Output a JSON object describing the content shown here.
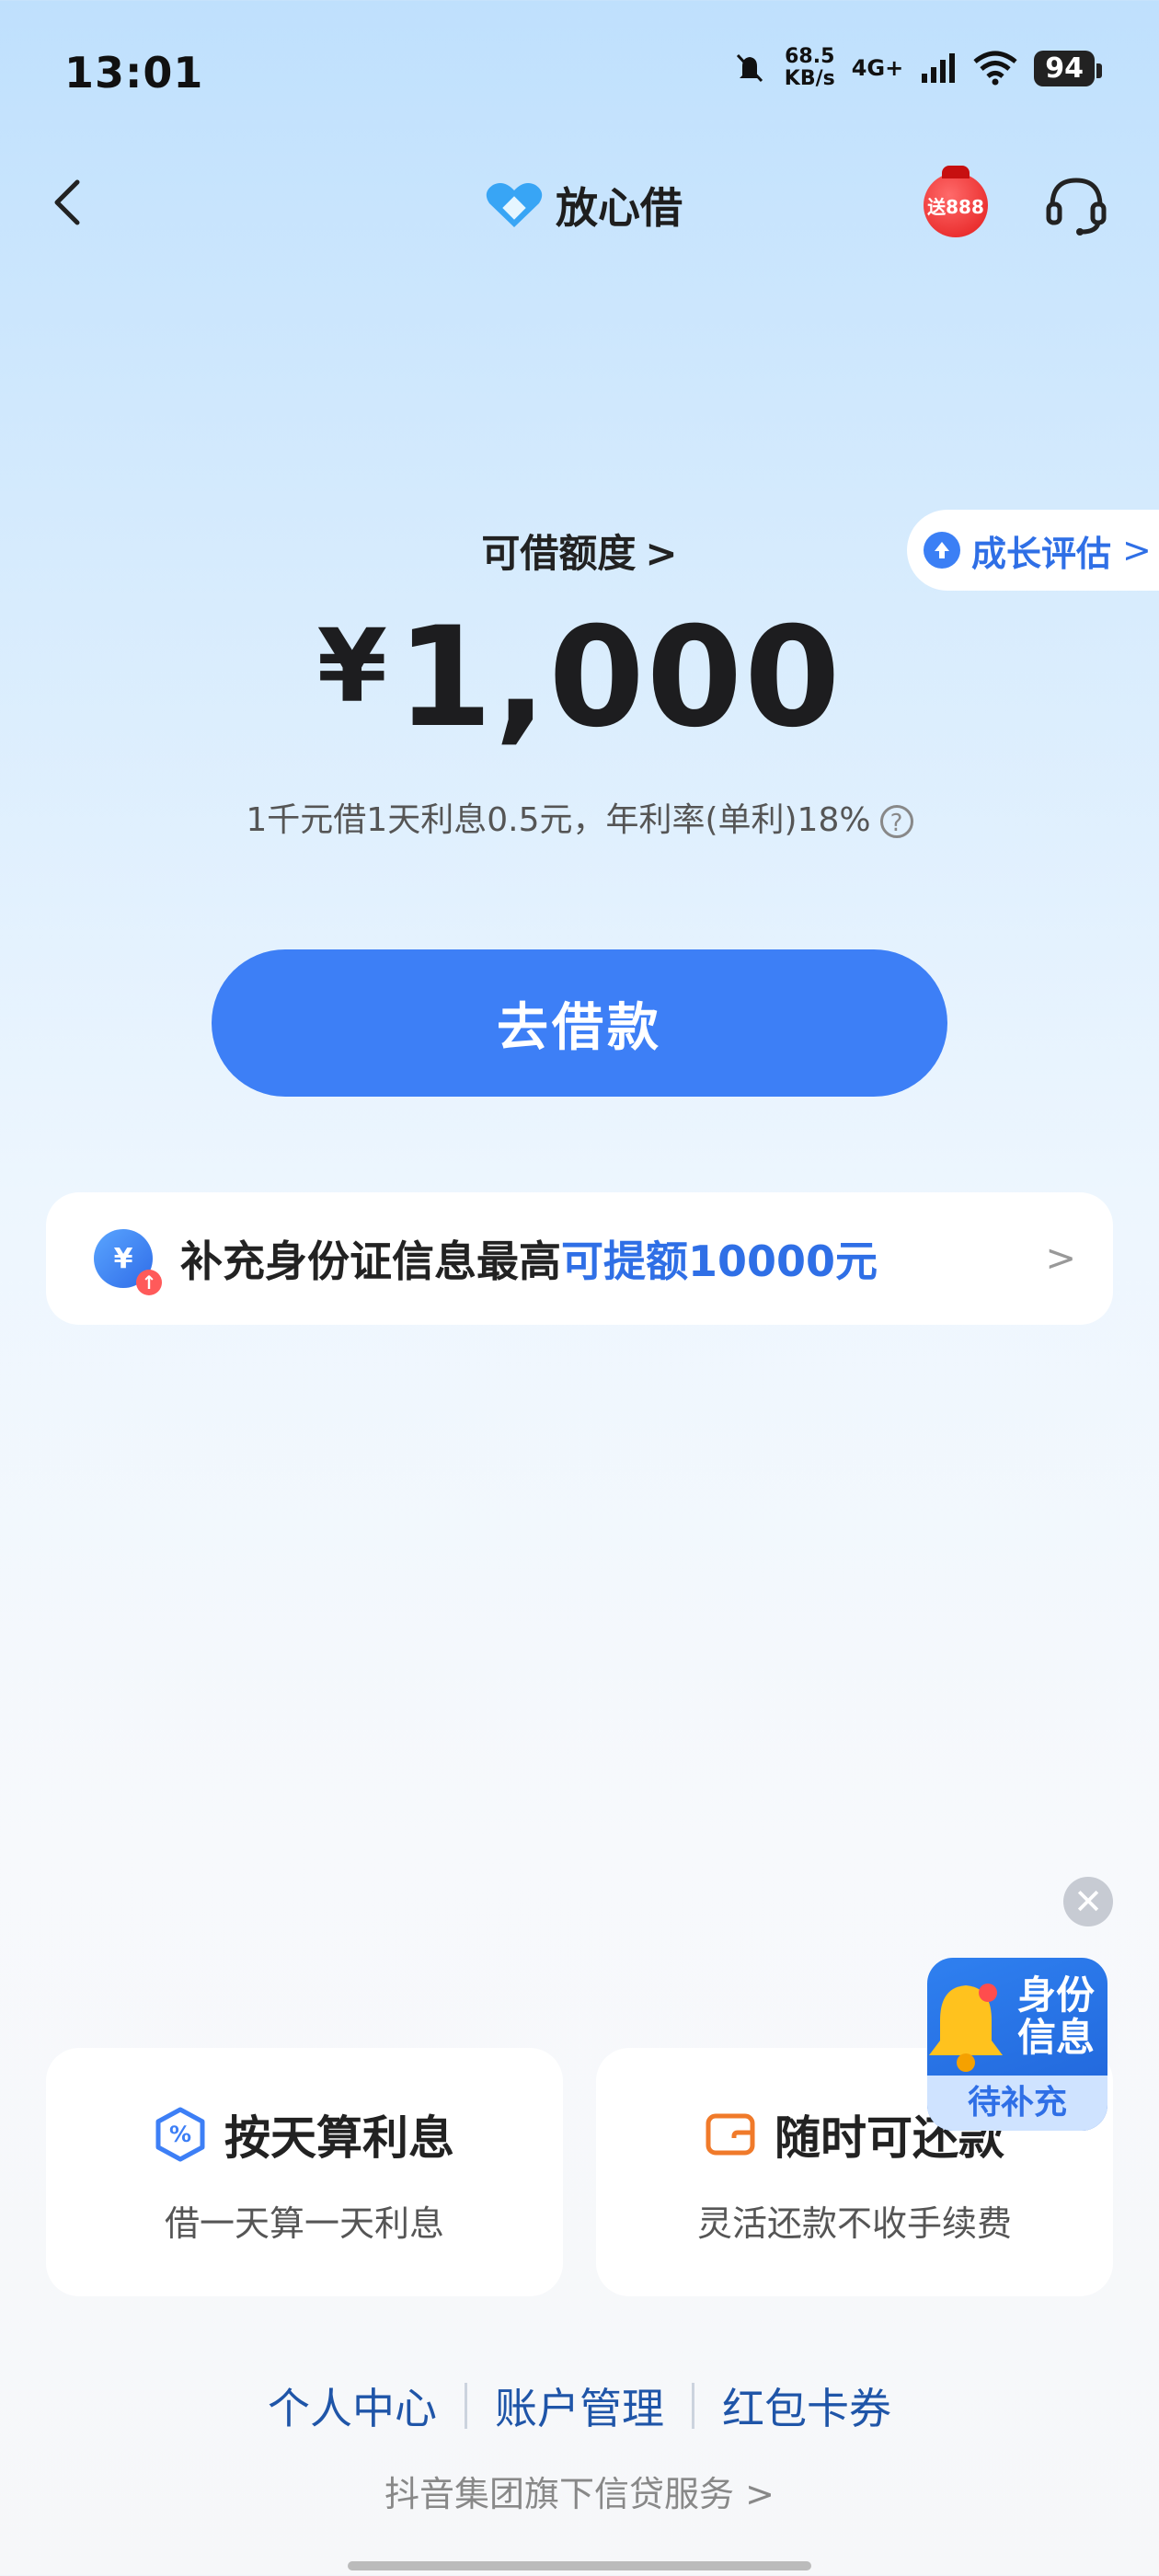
{
  "status_bar": {
    "time": "13:01",
    "speed_value": "68.5",
    "speed_unit": "KB/s",
    "network": "4G+",
    "battery": "94"
  },
  "nav": {
    "brand": "放心借",
    "gift_text": "送888"
  },
  "growth_tag": {
    "label": "成长评估",
    "chevron": ">"
  },
  "credit": {
    "title": "可借额度",
    "chevron": ">",
    "currency": "¥",
    "amount": "1,000",
    "rate_text": "1千元借1天利息0.5元，年利率(单利)18%",
    "help": "?"
  },
  "borrow_button": "去借款",
  "banner": {
    "text": "补充身份证信息最高",
    "highlight": "可提额10000元",
    "chevron": ">",
    "icon_char": "¥"
  },
  "floating": {
    "close": "✕",
    "title_line1": "身份",
    "title_line2": "信息",
    "status": "待补充"
  },
  "features": [
    {
      "title": "按天算利息",
      "subtitle": "借一天算一天利息"
    },
    {
      "title": "随时可还款",
      "subtitle": "灵活还款不收手续费"
    }
  ],
  "footer": {
    "links": [
      "个人中心",
      "账户管理",
      "红包卡券"
    ],
    "note": "抖音集团旗下信贷服务",
    "note_chevron": ">"
  },
  "colors": {
    "accent": "#3d7ff6",
    "link": "#2f6fe6"
  }
}
